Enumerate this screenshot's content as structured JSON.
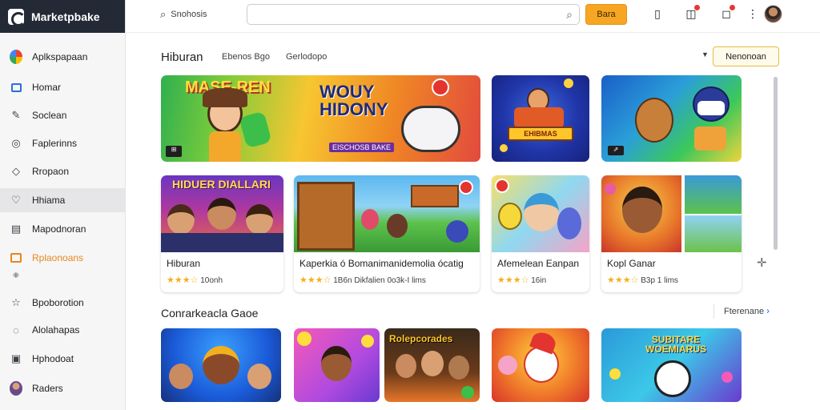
{
  "app": {
    "name": "Marketpbake"
  },
  "sidebar": {
    "items": [
      {
        "label": "Aplkspapaan",
        "icon": "apps-logo-icon"
      },
      {
        "label": "Homar",
        "icon": "home-icon"
      },
      {
        "label": "Soclean",
        "icon": "pen-icon"
      },
      {
        "label": "Faplerinns",
        "icon": "compass-icon"
      },
      {
        "label": "Rropaon",
        "icon": "tag-icon"
      },
      {
        "label": "Hhiama",
        "icon": "heart-icon"
      },
      {
        "label": "Mapodnoran",
        "icon": "document-icon"
      },
      {
        "label": "Rplaonoans",
        "icon": "folder-icon"
      },
      {
        "label": "",
        "icon": "expand-icon"
      },
      {
        "label": "Bpoborotion",
        "icon": "star-icon"
      },
      {
        "label": "Alolahapas",
        "icon": "location-icon"
      },
      {
        "label": "Hphodoat",
        "icon": "gift-icon"
      },
      {
        "label": "Raders",
        "icon": "user-avatar-icon"
      }
    ]
  },
  "topbar": {
    "search_small": "Snohosis",
    "search_value": "",
    "action_button": "Bara"
  },
  "main": {
    "title": "Hiburan",
    "crumb_1": "Ebenos Bgo",
    "crumb_2": "Gerlodopo",
    "sort_label": "Nenonoan",
    "cards": [
      {
        "title": "Hiburan",
        "rating": "★★★☆",
        "meta": "10onh"
      },
      {
        "title": "Kaperkia ó Bomanimanidemolia ócatig",
        "rating": "★★★☆",
        "meta": "1B6n Dikfalien 0o3k-I lims"
      },
      {
        "title": "Afemelean Eanpan",
        "rating": "★★★☆",
        "meta": "16in"
      },
      {
        "title": "Kopl Ganar",
        "rating": "★★★☆",
        "meta": "B3p 1 lims"
      }
    ],
    "section2_title": "Conrarkeacla Gaoe",
    "see_more": "Fterenane"
  },
  "banner_texts": {
    "b1_top": "MASE-REN",
    "b1_main": "WOUY HIDONY",
    "b1_sub": "EISCHOSB BAKE",
    "b2_label": "EHIBMAS",
    "c1_label": "HIDUER DIALLARI",
    "r2_c3_label": "Rolepcorades",
    "r2_c5_label": "SUBITARE WOEMIARUS"
  }
}
